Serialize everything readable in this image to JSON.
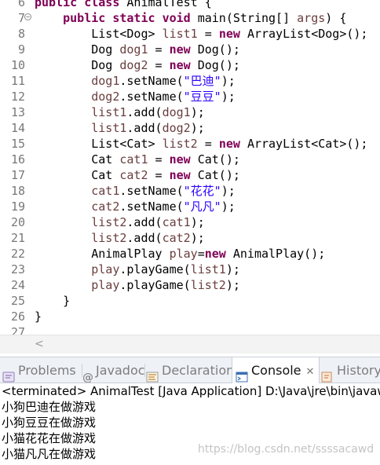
{
  "editor": {
    "lines": [
      {
        "num": "6",
        "segments": [
          [
            "kw",
            "public "
          ],
          [
            "kw",
            "class "
          ],
          [
            "",
            "AnimalTest {"
          ]
        ]
      },
      {
        "num": "7",
        "fold": "−",
        "segments": [
          [
            "",
            "    "
          ],
          [
            "kw",
            "public "
          ],
          [
            "kw",
            "static "
          ],
          [
            "kw",
            "void "
          ],
          [
            "",
            "main(String[] "
          ],
          [
            "lv",
            "args"
          ],
          [
            "",
            ") {"
          ]
        ]
      },
      {
        "num": "8",
        "segments": [
          [
            "",
            "        List<Dog> "
          ],
          [
            "lv",
            "list1"
          ],
          [
            "",
            " = "
          ],
          [
            "kw",
            "new "
          ],
          [
            "",
            "ArrayList<Dog>();"
          ]
        ]
      },
      {
        "num": "9",
        "segments": [
          [
            "",
            "        Dog "
          ],
          [
            "lv",
            "dog1"
          ],
          [
            "",
            " = "
          ],
          [
            "kw",
            "new "
          ],
          [
            "",
            "Dog();"
          ]
        ]
      },
      {
        "num": "10",
        "segments": [
          [
            "",
            "        Dog "
          ],
          [
            "lv",
            "dog2"
          ],
          [
            "",
            " = "
          ],
          [
            "kw",
            "new "
          ],
          [
            "",
            "Dog();"
          ]
        ]
      },
      {
        "num": "11",
        "segments": [
          [
            "lv",
            "        dog1"
          ],
          [
            "",
            ".setName("
          ],
          [
            "str",
            "\"巴迪\""
          ],
          [
            "",
            ");"
          ]
        ]
      },
      {
        "num": "12",
        "segments": [
          [
            "lv",
            "        dog2"
          ],
          [
            "",
            ".setName("
          ],
          [
            "str",
            "\"豆豆\""
          ],
          [
            "",
            ");"
          ]
        ]
      },
      {
        "num": "13",
        "segments": [
          [
            "lv",
            "        list1"
          ],
          [
            "",
            ".add("
          ],
          [
            "lv",
            "dog1"
          ],
          [
            "",
            ");"
          ]
        ]
      },
      {
        "num": "14",
        "segments": [
          [
            "lv",
            "        list1"
          ],
          [
            "",
            ".add("
          ],
          [
            "lv",
            "dog2"
          ],
          [
            "",
            ");"
          ]
        ]
      },
      {
        "num": "15",
        "segments": [
          [
            "",
            "        List<Cat> "
          ],
          [
            "lv",
            "list2"
          ],
          [
            "",
            " = "
          ],
          [
            "kw",
            "new "
          ],
          [
            "",
            "ArrayList<Cat>();"
          ]
        ]
      },
      {
        "num": "16",
        "segments": [
          [
            "",
            "        Cat "
          ],
          [
            "lv",
            "cat1"
          ],
          [
            "",
            " = "
          ],
          [
            "kw",
            "new "
          ],
          [
            "",
            "Cat();"
          ]
        ]
      },
      {
        "num": "17",
        "segments": [
          [
            "",
            "        Cat "
          ],
          [
            "lv",
            "cat2"
          ],
          [
            "",
            " = "
          ],
          [
            "kw",
            "new "
          ],
          [
            "",
            "Cat();"
          ]
        ]
      },
      {
        "num": "18",
        "segments": [
          [
            "lv",
            "        cat1"
          ],
          [
            "",
            ".setName("
          ],
          [
            "str",
            "\"花花\""
          ],
          [
            "",
            ");"
          ]
        ]
      },
      {
        "num": "19",
        "segments": [
          [
            "lv",
            "        cat2"
          ],
          [
            "",
            ".setName("
          ],
          [
            "str",
            "\"凡凡\""
          ],
          [
            "",
            ");"
          ]
        ]
      },
      {
        "num": "20",
        "segments": [
          [
            "lv",
            "        list2"
          ],
          [
            "",
            ".add("
          ],
          [
            "lv",
            "cat1"
          ],
          [
            "",
            ");"
          ]
        ]
      },
      {
        "num": "21",
        "segments": [
          [
            "lv",
            "        list2"
          ],
          [
            "",
            ".add("
          ],
          [
            "lv",
            "cat2"
          ],
          [
            "",
            ");"
          ]
        ]
      },
      {
        "num": "22",
        "segments": [
          [
            "",
            "        AnimalPlay "
          ],
          [
            "lv",
            "play"
          ],
          [
            "",
            "="
          ],
          [
            "kw",
            "new "
          ],
          [
            "",
            "AnimalPlay();"
          ]
        ]
      },
      {
        "num": "23",
        "segments": [
          [
            "lv",
            "        play"
          ],
          [
            "",
            ".playGame("
          ],
          [
            "lv",
            "list1"
          ],
          [
            "",
            ");"
          ]
        ]
      },
      {
        "num": "24",
        "segments": [
          [
            "lv",
            "        play"
          ],
          [
            "",
            ".playGame("
          ],
          [
            "lv",
            "list2"
          ],
          [
            "",
            ");"
          ]
        ]
      },
      {
        "num": "25",
        "segments": [
          [
            "",
            "    }"
          ]
        ]
      },
      {
        "num": "26",
        "segments": [
          [
            "",
            "}"
          ]
        ]
      },
      {
        "num": "27",
        "segments": []
      }
    ],
    "scroll_left_glyph": "<"
  },
  "tabs": {
    "problems": "Problems",
    "javadoc": "Javadoc",
    "declaration": "Declaration",
    "console": "Console",
    "console_close": "✕",
    "history": "History"
  },
  "console": {
    "header": "<terminated> AnimalTest [Java Application] D:\\Java\\jre\\bin\\javaw.exe",
    "output": [
      "小狗巴迪在做游戏",
      "小狗豆豆在做游戏",
      "小猫花花在做游戏",
      "小猫凡凡在做游戏"
    ],
    "watermark": "https://blog.csdn.net/ssssacawd"
  },
  "colors": {
    "keyword": "#7f0055",
    "local_variable": "#6a3e3e",
    "string": "#2a00ff"
  }
}
